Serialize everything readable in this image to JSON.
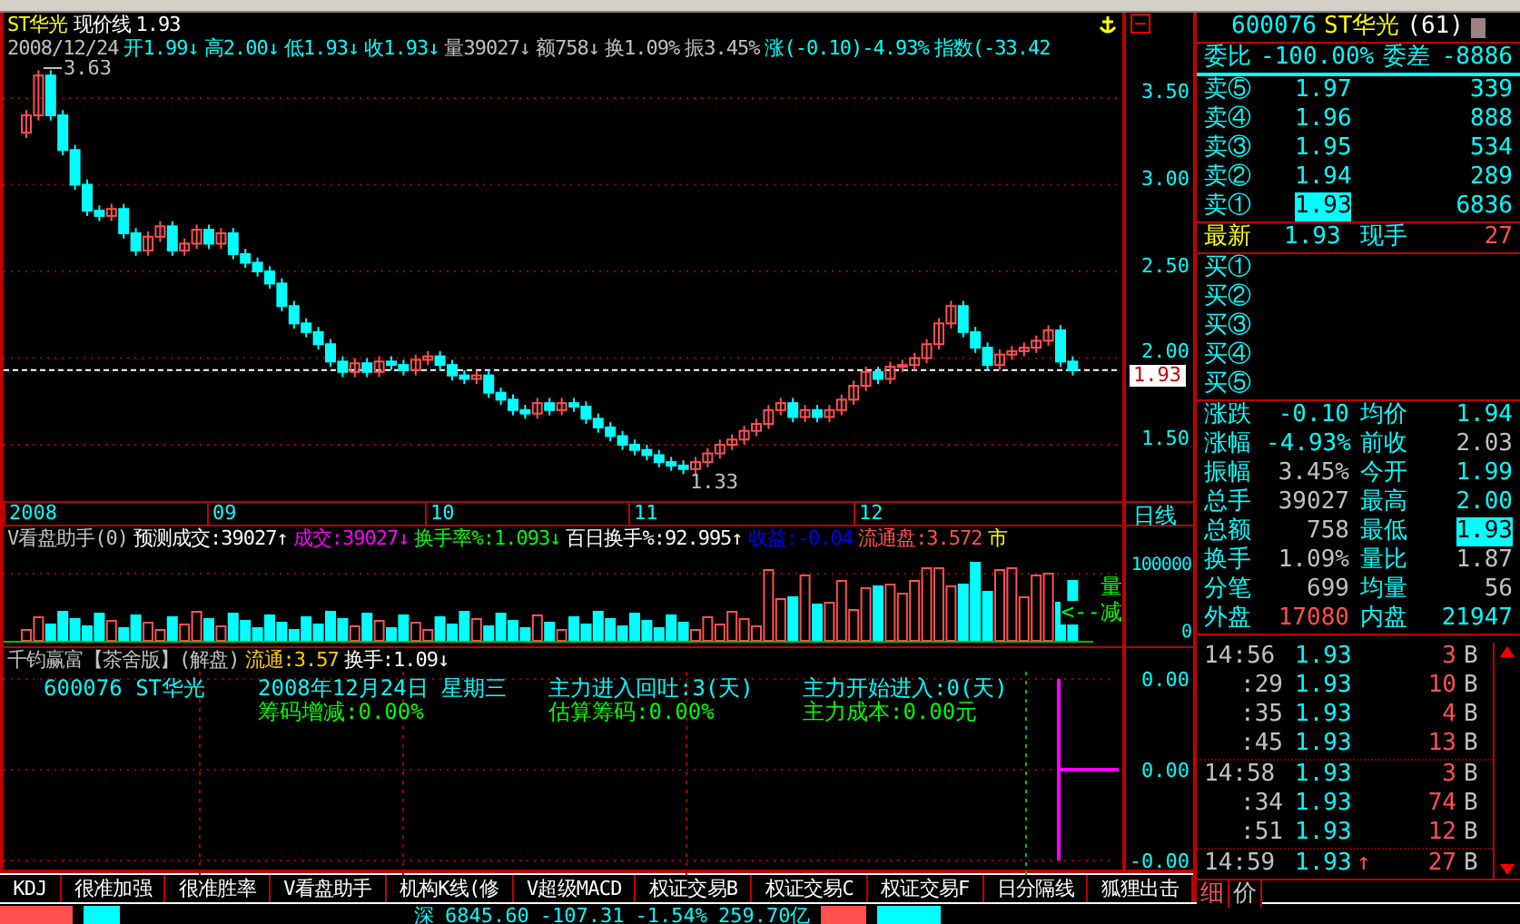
{
  "title_bar": {
    "symbol": "ST华光",
    "line_label": "现价线",
    "price": "1.93"
  },
  "info_line": [
    {
      "text": "2008/12/24",
      "color": "#c0c0c0"
    },
    {
      "text": "开1.99↓",
      "color": "#00ffff"
    },
    {
      "text": "高2.00↓",
      "color": "#00ffff"
    },
    {
      "text": "低1.93↓",
      "color": "#00ffff"
    },
    {
      "text": "收1.93↓",
      "color": "#00ffff"
    },
    {
      "text": "量39027↓",
      "color": "#c0c0c0"
    },
    {
      "text": "额758↓",
      "color": "#c0c0c0"
    },
    {
      "text": "换1.09%",
      "color": "#c0c0c0"
    },
    {
      "text": "振3.45%",
      "color": "#c0c0c0"
    },
    {
      "text": "涨(-0.10)-4.93%",
      "color": "#00ffff"
    },
    {
      "text": "指数(-33.42",
      "color": "#00ffff"
    }
  ],
  "price_chart": {
    "high_label": "3.63",
    "low_label": "1.33",
    "y_labels": [
      "3.50",
      "3.00",
      "2.50",
      "2.00",
      "1.50"
    ],
    "last_price": "1.93",
    "months": [
      "2008",
      "09",
      "10",
      "11",
      "12"
    ],
    "period": "日线"
  },
  "volume_panel": {
    "indicator": [
      {
        "text": "V看盘助手(0)",
        "color": "#c0c0c0"
      },
      {
        "text": "预测成交:39027↑",
        "color": "#ffffff"
      },
      {
        "text": "成交:39027↓",
        "color": "#ff00ff"
      },
      {
        "text": "换手率%:1.093↓",
        "color": "#00ff00"
      },
      {
        "text": "百日换手%:92.995↑",
        "color": "#ffffff"
      },
      {
        "text": "收益:-0.04",
        "color": "#0000ff"
      },
      {
        "text": "流通盘:3.572",
        "color": "#ff5050"
      },
      {
        "text": "市",
        "color": "#ffff00"
      }
    ],
    "y_labels": [
      "100000",
      "0"
    ],
    "legend_top": "量",
    "legend_bottom": "<--减"
  },
  "analysis_panel": {
    "title": [
      {
        "text": "千钧赢富【茶舍版】(解盘)",
        "color": "#c0c0c0"
      },
      {
        "text": "流通:3.57",
        "color": "#ffcc00"
      },
      {
        "text": "换手:1.09↓",
        "color": "#ffffff"
      }
    ],
    "notes": [
      {
        "text": "600076 ST华光",
        "color": "#00ffff"
      },
      {
        "text": "2008年12月24日 星期三",
        "color": "#00ffff"
      },
      {
        "text": "主力进入回吐:3(天)",
        "color": "#00ffff"
      },
      {
        "text": "主力开始进入:0(天)",
        "color": "#00ffff"
      },
      {
        "text": "筹码增减:0.00%",
        "color": "#00ff00"
      },
      {
        "text": "估算筹码:0.00%",
        "color": "#00ff00"
      },
      {
        "text": "主力成本:0.00元",
        "color": "#00ff00"
      }
    ],
    "y_labels": [
      "0.00",
      "0.00",
      "-0.00"
    ]
  },
  "indicator_tabs": [
    {
      "label": "KDJ",
      "selected": false
    },
    {
      "label": "很准加强",
      "selected": false
    },
    {
      "label": "很准胜率",
      "selected": false
    },
    {
      "label": "V看盘助手",
      "selected": false
    },
    {
      "label": "机构K线(修",
      "selected": false
    },
    {
      "label": "V超级MACD",
      "selected": false
    },
    {
      "label": "权证交易B",
      "selected": false
    },
    {
      "label": "权证交易C",
      "selected": false
    },
    {
      "label": "权证交易F",
      "selected": false
    },
    {
      "label": "日分隔线",
      "selected": false
    },
    {
      "label": "狐狸出击",
      "selected": false
    }
  ],
  "quote_panel": {
    "code": "600076",
    "name": "ST华光",
    "count": "(61)",
    "order_ratio_label": "委比",
    "order_ratio": "-100.00%",
    "order_diff_label": "委差",
    "order_diff": "-8886",
    "asks": [
      {
        "label": "卖⑤",
        "price": "1.97",
        "volume": "339",
        "selected": false
      },
      {
        "label": "卖④",
        "price": "1.96",
        "volume": "888",
        "selected": false
      },
      {
        "label": "卖③",
        "price": "1.95",
        "volume": "534",
        "selected": false
      },
      {
        "label": "卖②",
        "price": "1.94",
        "volume": "289",
        "selected": false
      },
      {
        "label": "卖①",
        "price": "1.93",
        "volume": "6836",
        "selected": true
      }
    ],
    "latest_label": "最新",
    "latest": "1.93",
    "last_volume_label": "现手",
    "last_volume": "27",
    "bids": [
      {
        "label": "买①"
      },
      {
        "label": "买②"
      },
      {
        "label": "买③"
      },
      {
        "label": "买④"
      },
      {
        "label": "买⑤"
      }
    ],
    "stats": [
      {
        "label": "涨跌",
        "value": "-0.10",
        "color": "#00ffff",
        "highlighted": false
      },
      {
        "label": "均价",
        "value": "1.94",
        "color": "#00ffff",
        "highlighted": false
      },
      {
        "label": "涨幅",
        "value": "-4.93%",
        "color": "#00ffff",
        "highlighted": false
      },
      {
        "label": "前收",
        "value": "2.03",
        "color": "#c0c0c0",
        "highlighted": false
      },
      {
        "label": "振幅",
        "value": "3.45%",
        "color": "#c0c0c0",
        "highlighted": false
      },
      {
        "label": "今开",
        "value": "1.99",
        "color": "#00ffff",
        "highlighted": false
      },
      {
        "label": "总手",
        "value": "39027",
        "color": "#c0c0c0",
        "highlighted": false
      },
      {
        "label": "最高",
        "value": "2.00",
        "color": "#00ffff",
        "highlighted": false
      },
      {
        "label": "总额",
        "value": "758",
        "color": "#c0c0c0",
        "highlighted": false
      },
      {
        "label": "最低",
        "value": "1.93",
        "color": "#00ffff",
        "highlighted": true
      },
      {
        "label": "换手",
        "value": "1.09%",
        "color": "#c0c0c0",
        "highlighted": false
      },
      {
        "label": "量比",
        "value": "1.87",
        "color": "#c0c0c0",
        "highlighted": false
      },
      {
        "label": "分笔",
        "value": "699",
        "color": "#c0c0c0",
        "highlighted": false
      },
      {
        "label": "均量",
        "value": "56",
        "color": "#c0c0c0",
        "highlighted": false
      },
      {
        "label": "外盘",
        "value": "17080",
        "color": "#ff5050",
        "highlighted": false
      },
      {
        "label": "内盘",
        "value": "21947",
        "color": "#00ffff",
        "highlighted": false
      }
    ],
    "trades": [
      {
        "time": "14:56",
        "price": "1.93",
        "volume": "3",
        "side": "B",
        "new_minute": true
      },
      {
        "time": ":29",
        "price": "1.93",
        "volume": "10",
        "side": "B",
        "new_minute": false
      },
      {
        "time": ":35",
        "price": "1.93",
        "volume": "4",
        "side": "B",
        "new_minute": false
      },
      {
        "time": ":45",
        "price": "1.93",
        "volume": "13",
        "side": "B",
        "new_minute": false
      },
      {
        "time": "14:58",
        "price": "1.93",
        "volume": "3",
        "side": "B",
        "new_minute": true
      },
      {
        "time": ":34",
        "price": "1.93",
        "volume": "74",
        "side": "B",
        "new_minute": false
      },
      {
        "time": ":51",
        "price": "1.93",
        "volume": "12",
        "side": "B",
        "new_minute": false
      },
      {
        "time": "14:59",
        "price": "1.93",
        "arrow": "↑",
        "volume": "27",
        "side": "B",
        "new_minute": true
      }
    ],
    "tabs": [
      {
        "label": "细",
        "selected": true
      },
      {
        "label": "价",
        "selected": false
      }
    ]
  },
  "status_bar": {
    "market": "深",
    "index": "6845.60",
    "change": "-107.31",
    "percent": "-1.54%",
    "turnover": "259.70亿"
  }
}
